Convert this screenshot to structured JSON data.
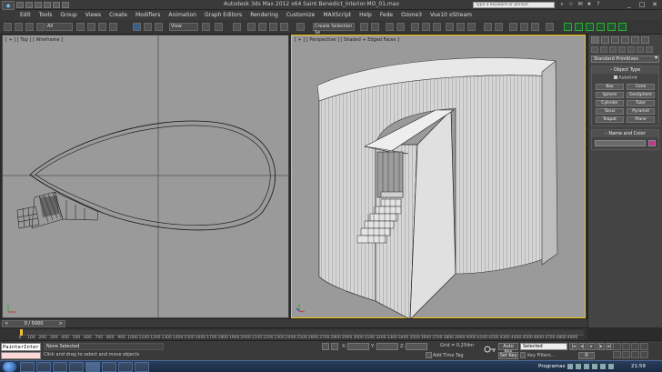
{
  "window": {
    "title": "Autodesk 3ds Max  2012 x64      Saint Benedict_Interior-MO_01.max",
    "search_placeholder": "Type a keyword or phrase",
    "controls": [
      "_",
      "□",
      "✕"
    ]
  },
  "menu": [
    "Edit",
    "Tools",
    "Group",
    "Views",
    "Create",
    "Modifiers",
    "Animation",
    "Graph Editors",
    "Rendering",
    "Customize",
    "MAXScript",
    "Help",
    "Fede",
    "Ozone3",
    "Vue10 xStream"
  ],
  "toolbar": {
    "filter_label": "All",
    "view_label": "View",
    "selection_set_placeholder": "Create Selection Se"
  },
  "viewports": {
    "left_label": "[ + ] [ Top ] [ Wireframe ]",
    "right_label": "[ + ] [ Perspective ] [ Shaded + Edged Faces ]"
  },
  "command_panel": {
    "category": "Standard Primitives",
    "object_type_title": "Object Type",
    "autogrid": "AutoGrid",
    "primitives": [
      "Box",
      "Cone",
      "Sphere",
      "GeoSphere",
      "Cylinder",
      "Tube",
      "Torus",
      "Pyramid",
      "Teapot",
      "Plane"
    ],
    "name_color_title": "Name and Color",
    "color": "#c2358a"
  },
  "timeline": {
    "frame": "0 / 5000",
    "ticks": [
      "0",
      "100",
      "200",
      "300",
      "400",
      "500",
      "600",
      "700",
      "800",
      "900",
      "1000",
      "1100",
      "1200",
      "1300",
      "1400",
      "1500",
      "1600",
      "1700",
      "1800",
      "1900",
      "2000",
      "2100",
      "2200",
      "2300",
      "2400",
      "2500",
      "2600",
      "2700",
      "2800",
      "2900",
      "3000",
      "3100",
      "3200",
      "3300",
      "3400",
      "3500",
      "3600",
      "3700",
      "3800",
      "3900",
      "4000",
      "4100",
      "4200",
      "4300",
      "4400",
      "4500",
      "4600",
      "4700",
      "4800",
      "4900"
    ],
    "slider_fraction": 0
  },
  "status": {
    "maxscript_text": "PainterInter",
    "selection": "None Selected",
    "prompt": "Click and drag to select and move objects",
    "x_label": "X:",
    "y_label": "Y:",
    "z_label": "Z:",
    "grid": "Grid = 0,254m",
    "add_time_tag": "Add Time Tag",
    "auto_key": "Auto Key",
    "set_key": "Set Key",
    "selected": "Selected",
    "key_filters": "Key Filters...",
    "current_frame": "0"
  },
  "taskbar": {
    "programs": "Programas",
    "clock": "21:59"
  }
}
